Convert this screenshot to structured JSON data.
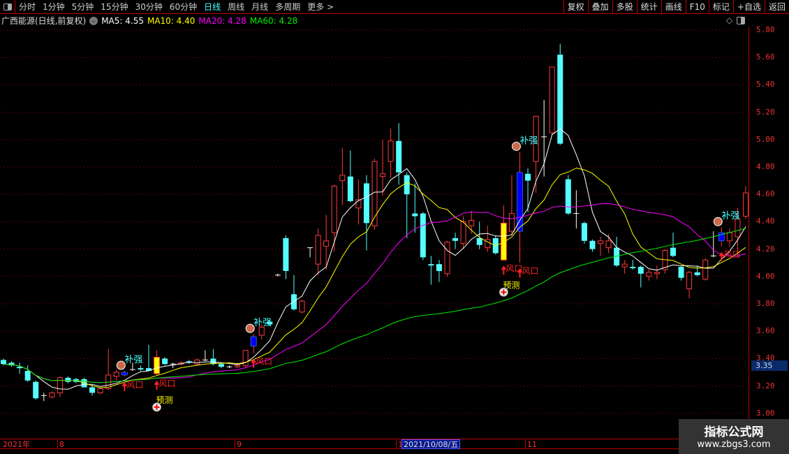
{
  "toolbar": {
    "periods": [
      "分时",
      "1分钟",
      "5分钟",
      "15分钟",
      "30分钟",
      "60分钟",
      "日线",
      "周线",
      "月线",
      "多周期",
      "更多 >"
    ],
    "active_period": "日线",
    "right_buttons": [
      "复权",
      "叠加",
      "多股",
      "统计",
      "画线",
      "F10",
      "标记",
      "+自选",
      "返回"
    ]
  },
  "info": {
    "title": "广西能源(日线,前复权)",
    "ma5": "MA5: 4.55",
    "ma10": "MA10: 4.40",
    "ma20": "MA20: 4.28",
    "ma60": "MA60: 4.28"
  },
  "colors": {
    "up": "#ff3b3b",
    "down": "#55ffff",
    "doji": "#ffffff",
    "ma5": "#ffffff",
    "ma10": "#ffff00",
    "ma20": "#ff00ff",
    "ma60": "#00ee00",
    "grid": "#a00000",
    "highlight_yellow": "#ffff00",
    "highlight_blue": "#0000ff"
  },
  "price_axis": {
    "labels": [
      "5.80",
      "5.60",
      "5.40",
      "5.20",
      "5.00",
      "4.80",
      "4.60",
      "4.40",
      "4.20",
      "4.00",
      "3.80",
      "3.60",
      "3.40",
      "3.20",
      "3.00"
    ],
    "current": "3.35"
  },
  "x_axis": {
    "year_label": "2021年",
    "labels": [
      {
        "label": "8",
        "index": 7
      },
      {
        "label": "9",
        "index": 29
      },
      {
        "label": "1",
        "index": 49
      },
      {
        "label": "11",
        "index": 65
      }
    ],
    "selected": {
      "label": "2021/10/08/五",
      "index": 49
    }
  },
  "watermark": {
    "line1": "指标公式网",
    "line2": "www.zbgs3.com"
  },
  "chart_data": {
    "type": "candlestick",
    "ylim": [
      3.0,
      5.8
    ],
    "grid": true,
    "ohlc": [
      [
        3.39,
        3.4,
        3.35,
        3.36
      ],
      [
        3.37,
        3.38,
        3.34,
        3.35
      ],
      [
        3.34,
        3.37,
        3.29,
        3.33
      ],
      [
        3.31,
        3.35,
        3.23,
        3.24
      ],
      [
        3.23,
        3.24,
        3.1,
        3.11
      ],
      [
        3.13,
        3.15,
        3.09,
        3.13
      ],
      [
        3.12,
        3.16,
        3.11,
        3.15
      ],
      [
        3.15,
        3.27,
        3.12,
        3.26
      ],
      [
        3.26,
        3.27,
        3.22,
        3.23
      ],
      [
        3.25,
        3.26,
        3.22,
        3.23
      ],
      [
        3.25,
        3.26,
        3.19,
        3.19
      ],
      [
        3.19,
        3.21,
        3.13,
        3.15
      ],
      [
        3.15,
        3.19,
        3.14,
        3.18
      ],
      [
        3.18,
        3.47,
        3.17,
        3.28
      ],
      [
        3.27,
        3.32,
        3.24,
        3.3
      ],
      [
        3.28,
        3.31,
        3.27,
        3.3
      ],
      [
        3.32,
        3.37,
        3.31,
        3.32
      ],
      [
        3.33,
        3.35,
        3.31,
        3.32
      ],
      [
        3.33,
        3.5,
        3.31,
        3.31
      ],
      [
        3.29,
        3.46,
        3.28,
        3.41
      ],
      [
        3.4,
        3.41,
        3.35,
        3.36
      ],
      [
        3.36,
        3.37,
        3.33,
        3.36
      ],
      [
        3.36,
        3.38,
        3.35,
        3.37
      ],
      [
        3.38,
        3.39,
        3.36,
        3.37
      ],
      [
        3.36,
        3.4,
        3.35,
        3.39
      ],
      [
        3.39,
        3.46,
        3.38,
        3.39
      ],
      [
        3.4,
        3.47,
        3.35,
        3.36
      ],
      [
        3.36,
        3.37,
        3.33,
        3.34
      ],
      [
        3.34,
        3.35,
        3.33,
        3.34
      ],
      [
        3.34,
        3.37,
        3.33,
        3.35
      ],
      [
        3.35,
        3.46,
        3.33,
        3.46
      ],
      [
        3.49,
        3.58,
        3.44,
        3.56
      ],
      [
        3.57,
        3.65,
        3.54,
        3.63
      ],
      [
        3.67,
        3.68,
        3.64,
        3.65
      ],
      [
        4.01,
        4.02,
        4.0,
        4.01
      ],
      [
        4.28,
        4.3,
        3.98,
        4.04
      ],
      [
        3.87,
        4.01,
        3.75,
        3.76
      ],
      [
        3.74,
        3.83,
        3.73,
        3.82
      ],
      [
        4.21,
        4.21,
        4.14,
        4.21
      ],
      [
        4.09,
        4.35,
        4.01,
        4.3
      ],
      [
        4.22,
        4.45,
        4.05,
        4.26
      ],
      [
        4.32,
        4.67,
        4.18,
        4.66
      ],
      [
        4.7,
        4.94,
        4.52,
        4.74
      ],
      [
        4.73,
        4.92,
        4.54,
        4.55
      ],
      [
        4.5,
        4.71,
        4.38,
        4.56
      ],
      [
        4.68,
        4.74,
        4.19,
        4.39
      ],
      [
        4.37,
        4.86,
        4.34,
        4.84
      ],
      [
        4.73,
        5.0,
        4.59,
        4.75
      ],
      [
        4.84,
        5.08,
        4.72,
        4.99
      ],
      [
        4.99,
        5.12,
        4.67,
        4.76
      ],
      [
        4.74,
        4.76,
        4.28,
        4.6
      ],
      [
        4.46,
        4.68,
        4.32,
        4.44
      ],
      [
        4.46,
        4.47,
        4.12,
        4.14
      ],
      [
        4.09,
        4.15,
        3.94,
        4.08
      ],
      [
        4.09,
        4.12,
        3.96,
        4.04
      ],
      [
        4.02,
        4.26,
        4.0,
        4.25
      ],
      [
        4.28,
        4.32,
        4.2,
        4.26
      ],
      [
        4.24,
        4.44,
        4.2,
        4.4
      ],
      [
        4.37,
        4.48,
        4.31,
        4.41
      ],
      [
        4.28,
        4.4,
        4.2,
        4.23
      ],
      [
        4.21,
        4.37,
        4.18,
        4.27
      ],
      [
        4.28,
        4.3,
        4.16,
        4.17
      ],
      [
        4.12,
        4.52,
        4.12,
        4.39
      ],
      [
        4.33,
        4.74,
        4.3,
        4.46
      ],
      [
        4.33,
        4.91,
        4.1,
        4.76
      ],
      [
        4.75,
        4.79,
        4.47,
        4.7
      ],
      [
        4.84,
        5.17,
        4.61,
        5.17
      ],
      [
        5.02,
        5.29,
        4.73,
        5.02
      ],
      [
        5.05,
        5.53,
        5.04,
        5.53
      ],
      [
        5.62,
        5.7,
        4.96,
        4.97
      ],
      [
        4.71,
        4.74,
        4.45,
        4.46
      ],
      [
        4.46,
        4.63,
        4.35,
        4.46
      ],
      [
        4.39,
        4.4,
        4.24,
        4.26
      ],
      [
        4.26,
        4.27,
        4.18,
        4.2
      ],
      [
        4.24,
        4.29,
        4.15,
        4.26
      ],
      [
        4.21,
        4.31,
        4.17,
        4.26
      ],
      [
        4.21,
        4.29,
        4.07,
        4.08
      ],
      [
        4.07,
        4.12,
        4.02,
        4.09
      ],
      [
        4.07,
        4.12,
        4.05,
        4.06
      ],
      [
        4.07,
        4.08,
        3.92,
        4.02
      ],
      [
        4.0,
        4.05,
        3.97,
        4.03
      ],
      [
        4.02,
        4.08,
        3.98,
        4.03
      ],
      [
        4.05,
        4.2,
        4.02,
        4.19
      ],
      [
        4.21,
        4.32,
        4.14,
        4.15
      ],
      [
        4.07,
        4.08,
        3.97,
        3.99
      ],
      [
        3.91,
        4.04,
        3.84,
        4.03
      ],
      [
        4.03,
        4.08,
        4.0,
        4.01
      ],
      [
        3.98,
        4.13,
        3.97,
        4.12
      ],
      [
        4.15,
        4.33,
        4.14,
        4.15
      ],
      [
        4.26,
        4.36,
        4.22,
        4.32
      ],
      [
        4.26,
        4.35,
        4.22,
        4.32
      ],
      [
        4.29,
        4.5,
        4.15,
        4.42
      ],
      [
        4.44,
        4.66,
        4.42,
        4.61
      ]
    ],
    "highlight_yellow": [
      19,
      62
    ],
    "highlight_blue": [
      15,
      31,
      64,
      89
    ],
    "moving_averages": [
      {
        "name": "MA5",
        "period": 5
      },
      {
        "name": "MA10",
        "period": 10
      },
      {
        "name": "MA20",
        "period": 20
      },
      {
        "name": "MA60",
        "period": 60
      }
    ],
    "signals": {
      "buqiang": {
        "label": "补强",
        "indices": [
          15,
          31,
          64,
          89
        ]
      },
      "fengkou": {
        "label": "风口",
        "indices": [
          15,
          19,
          31,
          62,
          64,
          89
        ]
      },
      "yuce": {
        "label": "预测",
        "indices": [
          19,
          62
        ]
      }
    }
  }
}
